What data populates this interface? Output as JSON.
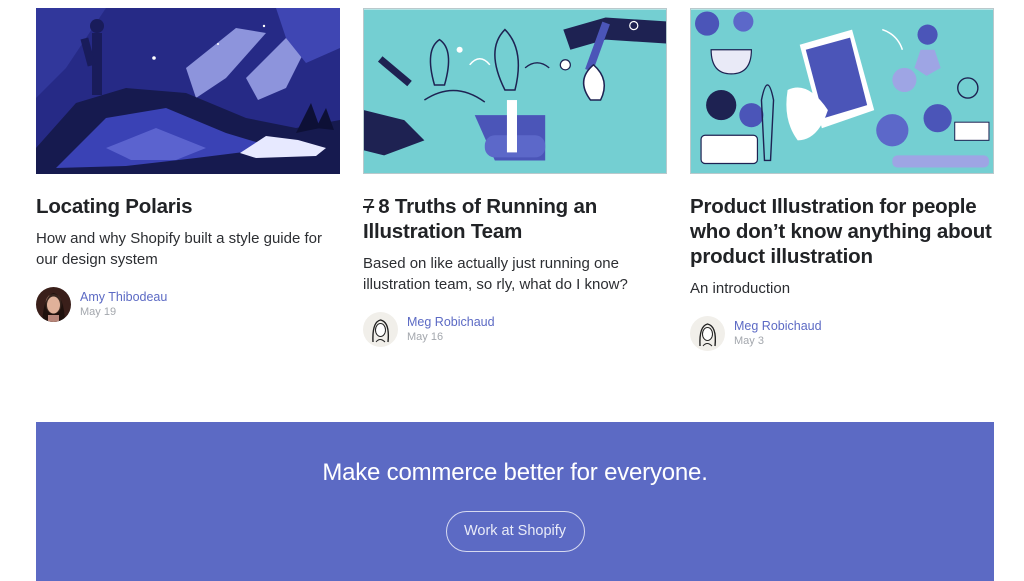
{
  "articles": [
    {
      "image": "Polaris illustration: person on hill under night sky with aurora",
      "title": "Locating Polaris",
      "title_strike": "",
      "subtitle": "How and why Shopify built a style guide for our design system",
      "author": "Amy Thibodeau",
      "date": "May 19"
    },
    {
      "image": "Illustration team: hands drawing plants on teal background",
      "title": "8 Truths of Running an Illustration Team",
      "title_strike": "7",
      "subtitle": "Based on like actually just running one illustration team, so rly, what do I know?",
      "author": "Meg Robichaud",
      "date": "May 16"
    },
    {
      "image": "Product illustration: phone, baking tools and cookies on teal background",
      "title": "Product Illustration for people who don’t know anything about product illustration",
      "title_strike": "",
      "subtitle": "An introduction",
      "author": "Meg Robichaud",
      "date": "May 3"
    }
  ],
  "banner": {
    "heading": "Make commerce better for everyone.",
    "button": "Work at Shopify"
  },
  "colors": {
    "accent": "#5c6ac4",
    "banner_bg": "#5c6ac4",
    "teal": "#74cfd2",
    "navy": "#2b2f8a"
  }
}
